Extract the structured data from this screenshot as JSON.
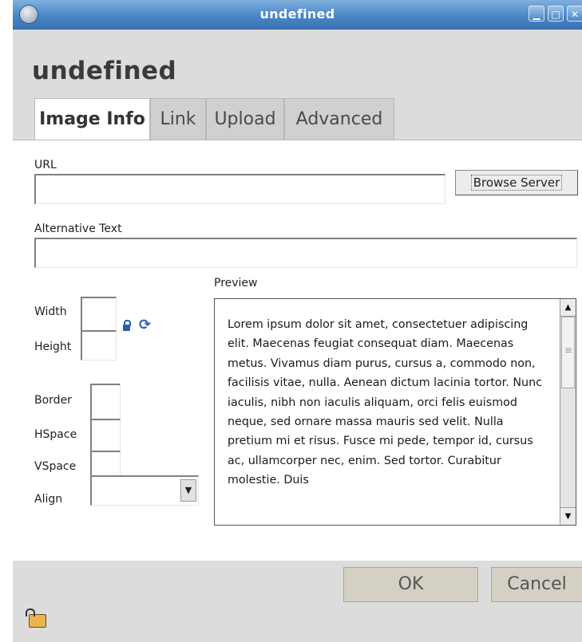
{
  "window": {
    "title": "undefined"
  },
  "dialog": {
    "title": "undefined"
  },
  "tabs": [
    {
      "label": "Image Info"
    },
    {
      "label": "Link"
    },
    {
      "label": "Upload"
    },
    {
      "label": "Advanced"
    }
  ],
  "form": {
    "url": {
      "label": "URL",
      "value": ""
    },
    "browse_label": "Browse Server",
    "alt_text": {
      "label": "Alternative Text",
      "value": ""
    },
    "width_label": "Width",
    "height_label": "Height",
    "border_label": "Border",
    "hspace_label": "HSpace",
    "vspace_label": "VSpace",
    "align_label": "Align",
    "align_value": ""
  },
  "preview": {
    "label": "Preview",
    "text": "Lorem ipsum dolor sit amet, consectetuer adipiscing elit. Maecenas feugiat consequat diam. Maecenas metus. Vivamus diam purus, cursus a, commodo non, facilisis vitae, nulla. Aenean dictum lacinia tortor. Nunc iaculis, nibh non iaculis aliquam, orci felis euismod neque, sed ornare massa mauris sed velit. Nulla pretium mi et risus. Fusce mi pede, tempor id, cursus ac, ullamcorper nec, enim. Sed tortor. Curabitur molestie. Duis"
  },
  "buttons": {
    "ok": "OK",
    "cancel": "Cancel"
  },
  "icons": {
    "app": "app-logo-icon",
    "lock": "lock-icon",
    "reset": "reset-size-icon",
    "corner": "unlock-icon"
  }
}
